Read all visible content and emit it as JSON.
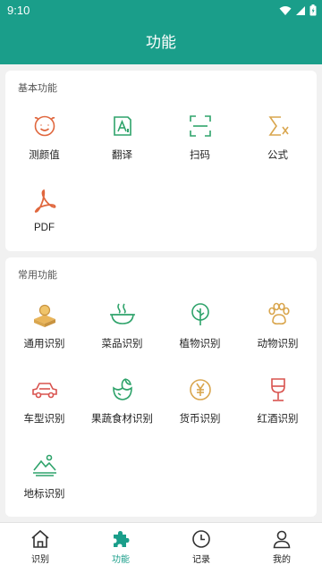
{
  "status_bar": {
    "time": "9:10",
    "icons": [
      "wifi-icon",
      "signal-icon",
      "battery-icon"
    ]
  },
  "app_bar": {
    "title": "功能"
  },
  "colors": {
    "primary": "#1a9e8a",
    "accent_orange": "#e0673e",
    "accent_green": "#2fa36b",
    "accent_gold": "#d9a64e",
    "accent_red": "#d9534f"
  },
  "basic_section": {
    "title": "基本功能",
    "items": [
      {
        "label": "测颜值",
        "icon": "face-icon"
      },
      {
        "label": "翻译",
        "icon": "translate-icon"
      },
      {
        "label": "扫码",
        "icon": "scan-icon"
      },
      {
        "label": "公式",
        "icon": "formula-icon"
      },
      {
        "label": "PDF",
        "icon": "pdf-icon"
      }
    ]
  },
  "common_section": {
    "title": "常用功能",
    "items": [
      {
        "label": "通用识别",
        "icon": "box-icon"
      },
      {
        "label": "菜品识别",
        "icon": "bowl-icon"
      },
      {
        "label": "植物识别",
        "icon": "tree-icon"
      },
      {
        "label": "动物识别",
        "icon": "paw-icon"
      },
      {
        "label": "车型识别",
        "icon": "car-icon"
      },
      {
        "label": "果蔬食材识别",
        "icon": "vegetable-icon"
      },
      {
        "label": "货币识别",
        "icon": "coin-icon"
      },
      {
        "label": "红酒识别",
        "icon": "wine-icon"
      },
      {
        "label": "地标识别",
        "icon": "landmark-icon"
      }
    ]
  },
  "tab_bar": {
    "active": "功能",
    "tabs": [
      {
        "label": "识别",
        "icon": "home-icon"
      },
      {
        "label": "功能",
        "icon": "puzzle-icon"
      },
      {
        "label": "记录",
        "icon": "clock-icon"
      },
      {
        "label": "我的",
        "icon": "person-icon"
      }
    ]
  }
}
